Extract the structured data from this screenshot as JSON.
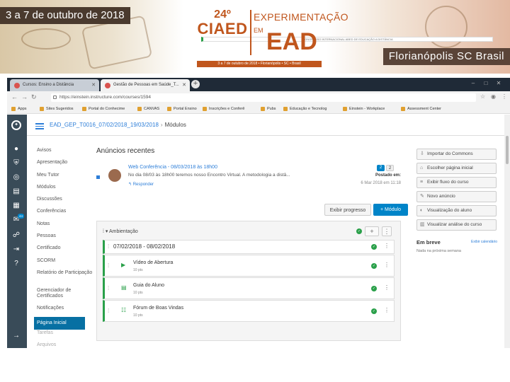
{
  "banner": {
    "dates": "3 a 7 de outubro de 2018",
    "ciaed_number": "24º",
    "ciaed_name": "CIAED",
    "ciaed_sub": "CONGRESSO INTERNACIONAL ABED DE EDUCAÇÃO A DISTÂNCIA",
    "experimentacao": "EXPERIMENTAÇÃO",
    "em": "EM",
    "ead": "EAD",
    "date_bar": "3 a 7 de outubro de 2018 • Florianópolis • SC • Brasil",
    "city": "Florianópolis  SC  Brasil"
  },
  "browser": {
    "tabs": [
      {
        "label": "Cursos: Ensino a Distância"
      },
      {
        "label": "Gestão de Pessoas em Saúde_T..."
      }
    ],
    "url": "https://einstein.instructure.com/courses/1594",
    "bookmarks": [
      "Apps",
      "Sites Sugeridos",
      "Portal do Conhecime",
      "CANVAS",
      "Portal Ensino",
      "Inscrições e Conferê",
      "Pubs",
      "Educação e Tecnolog",
      "Einstein - Workplace",
      "Assessment Center"
    ]
  },
  "colors": {
    "accent": "#0084c8",
    "nav_bg": "#394b58",
    "success": "#2aa04a"
  },
  "breadcrumb": {
    "course": "EAD_GEP_T0016_07/02/2018_19/03/2018",
    "separator": "›",
    "current": "Módulos"
  },
  "course_nav": [
    "Avisos",
    "Apresentação",
    "Meu Tutor",
    "Módulos",
    "Discussões",
    "Conferências",
    "Notas",
    "Pessoas",
    "Certificado",
    "SCORM",
    "Relatório de Participação",
    "Gerenciador de Certificados",
    "Notificações",
    "Página Inicial",
    "Tarefas",
    "Arquivos"
  ],
  "announcements": {
    "heading": "Anúncios recentes",
    "item": {
      "title": "Web Conferência - 08/03/2018 às 18h00",
      "message": "No dia 08/03 às 18h00 teremos nosso Encontro Virtual. A metodologia a distâ...",
      "reply": "Responder",
      "count_a": "2",
      "count_b": "2",
      "posted_label": "Postado em:",
      "posted_date": "6 Mar 2018 em 11:18"
    }
  },
  "actions": {
    "progress": "Exibir progresso",
    "add_module": "+ Módulo"
  },
  "module": {
    "name": "Ambientação",
    "submodule": "07/02/2018 - 08/02/2018",
    "items": [
      {
        "name": "Vídeo de Abertura",
        "points": "10 pts"
      },
      {
        "name": "Guia do Aluno",
        "points": "10 pts"
      },
      {
        "name": "Fórum de Boas Vindas",
        "points": "10 pts"
      }
    ]
  },
  "sidebar": {
    "buttons": [
      {
        "label": "Importar do Commons",
        "icon": "import-icon"
      },
      {
        "label": "Escolher página inicial",
        "icon": "home-icon"
      },
      {
        "label": "Exibir fluxo do curso",
        "icon": "stream-icon"
      },
      {
        "label": "Novo anúncio",
        "icon": "announcement-icon"
      },
      {
        "label": "Visualização do aluno",
        "icon": "student-view-icon"
      },
      {
        "label": "Visualizar análise do curso",
        "icon": "analytics-icon"
      }
    ],
    "coming_up": "Em breve",
    "calendar_link": "Exibir calendário",
    "nothing": "Nada na próxima semana"
  }
}
